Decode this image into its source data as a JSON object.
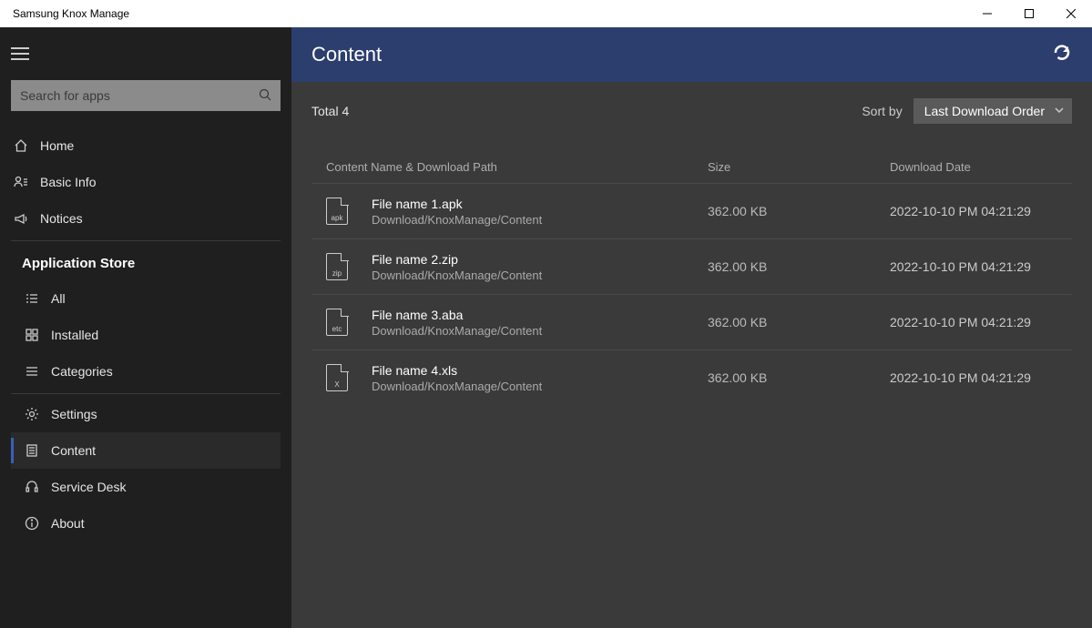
{
  "window": {
    "title": "Samsung Knox Manage"
  },
  "search": {
    "placeholder": "Search for apps"
  },
  "nav": {
    "home": "Home",
    "basic": "Basic Info",
    "notices": "Notices",
    "store_header": "Application Store",
    "all": "All",
    "installed": "Installed",
    "categories": "Categories",
    "settings": "Settings",
    "content": "Content",
    "service": "Service Desk",
    "about": "About"
  },
  "page": {
    "title": "Content",
    "total_label": "Total 4",
    "sort_label": "Sort by",
    "sort_value": "Last Download Order"
  },
  "columns": {
    "name": "Content Name & Download Path",
    "size": "Size",
    "date": "Download Date"
  },
  "rows": [
    {
      "type": "apk",
      "name": "File name 1.apk",
      "path": "Download/KnoxManage/Content",
      "size": "362.00 KB",
      "date": "2022-10-10 PM 04:21:29"
    },
    {
      "type": "zip",
      "name": "File name 2.zip",
      "path": "Download/KnoxManage/Content",
      "size": "362.00 KB",
      "date": "2022-10-10 PM 04:21:29"
    },
    {
      "type": "etc",
      "name": "File name 3.aba",
      "path": "Download/KnoxManage/Content",
      "size": "362.00 KB",
      "date": "2022-10-10 PM 04:21:29"
    },
    {
      "type": "X",
      "name": "File name 4.xls",
      "path": "Download/KnoxManage/Content",
      "size": "362.00 KB",
      "date": "2022-10-10 PM 04:21:29"
    }
  ]
}
